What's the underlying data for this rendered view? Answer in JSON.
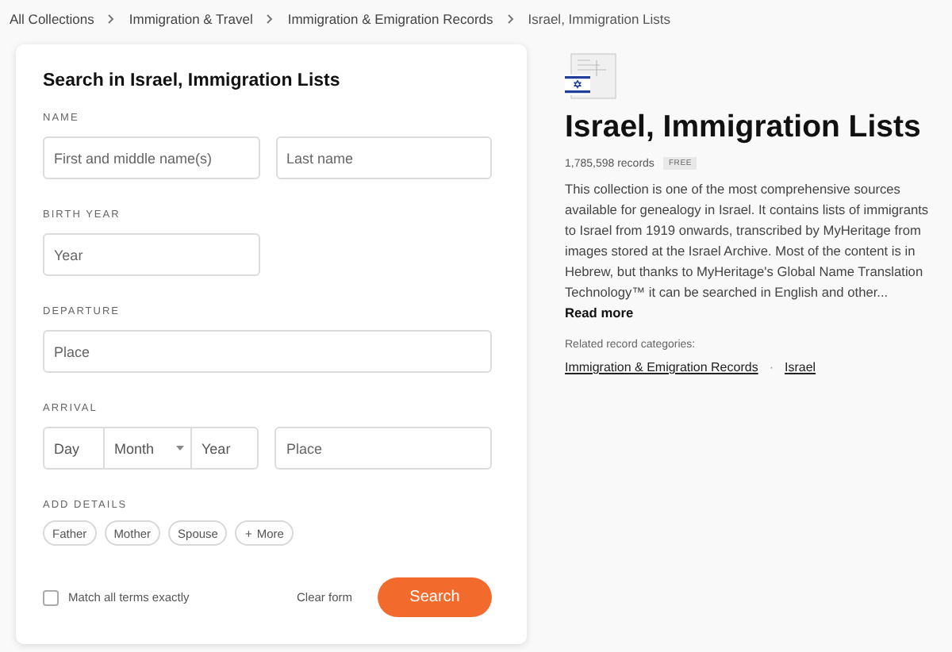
{
  "breadcrumbs": [
    "All Collections",
    "Immigration & Travel",
    "Immigration & Emigration Records",
    "Israel, Immigration Lists"
  ],
  "form": {
    "title": "Search in Israel, Immigration Lists",
    "sections": [
      {
        "label": "NAME",
        "fields": [
          {
            "kind": "text",
            "placeholder": "First and middle name(s)"
          },
          {
            "kind": "text",
            "placeholder": "Last name"
          }
        ]
      },
      {
        "label": "BIRTH YEAR",
        "fields": [
          {
            "kind": "half",
            "placeholder": "Year"
          }
        ]
      },
      {
        "label": "DEPARTURE",
        "fields": [
          {
            "kind": "wide",
            "placeholder": "Place"
          }
        ]
      },
      {
        "label": "ARRIVAL",
        "fields": [
          {
            "kind": "date",
            "day": "Day",
            "month": "Month",
            "year": "Year"
          },
          {
            "kind": "text",
            "placeholder": "Place"
          }
        ]
      }
    ],
    "details_label": "ADD DETAILS",
    "details": [
      {
        "label": "Father",
        "kind": "plain"
      },
      {
        "label": "Mother",
        "kind": "plain"
      },
      {
        "label": "Spouse",
        "kind": "plain"
      },
      {
        "label": "More",
        "kind": "more",
        "icon": "+"
      }
    ],
    "match_exact": {
      "label": "Match all terms exactly",
      "checked": false
    },
    "clear": "Clear form",
    "search": "Search"
  },
  "collection": {
    "title": "Israel, Immigration Lists",
    "records": "1,785,598 records",
    "badge": "FREE",
    "description": "This collection is one of the most comprehensive sources available for genealogy in Israel. It contains lists of immigrants to Israel from 1919 onwards, transcribed by MyHeritage from images stored at the Israel Archive. Most of the content is in Hebrew, but thanks to MyHeritage's Global Name Translation Technology™ it can be searched in English and other...",
    "read_more": "Read more",
    "related_label": "Related record categories:",
    "related": [
      "Immigration & Emigration Records",
      "Israel"
    ],
    "separator": "·"
  }
}
